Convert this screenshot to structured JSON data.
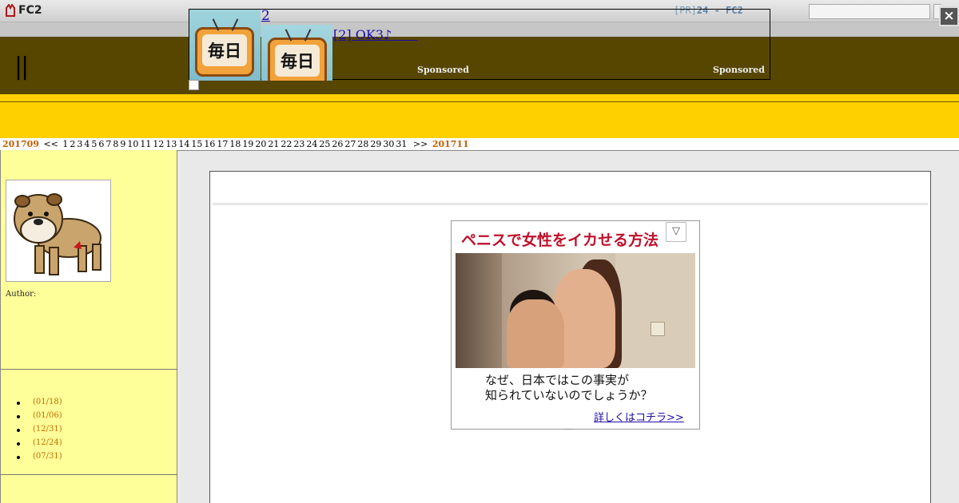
{
  "topbar": {
    "logo_text": "FC2",
    "pr_prefix": "[PR]",
    "pr_text": "24 - FC2"
  },
  "header": {
    "title": "||"
  },
  "ad": {
    "number_link": "2",
    "text_link": "[2] OK3♪　　",
    "thumb_label": "毎日",
    "sponsored_1": "Sponsored",
    "sponsored_2": "Sponsored",
    "close_label": "×"
  },
  "calendar": {
    "prev_month": "201709",
    "prev_arrow": "<<",
    "days": [
      "1",
      "2",
      "3",
      "4",
      "5",
      "6",
      "7",
      "8",
      "9",
      "10",
      "11",
      "12",
      "13",
      "14",
      "15",
      "16",
      "17",
      "18",
      "19",
      "20",
      "21",
      "22",
      "23",
      "24",
      "25",
      "26",
      "27",
      "28",
      "29",
      "30",
      "31"
    ],
    "next_arrow": ">>",
    "next_month": "201711"
  },
  "sidebar": {
    "author_label": "Author:",
    "entries": [
      "(01/18)",
      "(01/06)",
      "(12/31)",
      "(12/24)",
      "(07/31)"
    ]
  },
  "banner": {
    "headline": "ペニスで女性をイカせる方法",
    "badge": "▽",
    "body_line1": "なぜ、日本ではこの事実が",
    "body_line2": "知られていないのでしょうか？",
    "link": "詳しくはコチラ>>"
  }
}
